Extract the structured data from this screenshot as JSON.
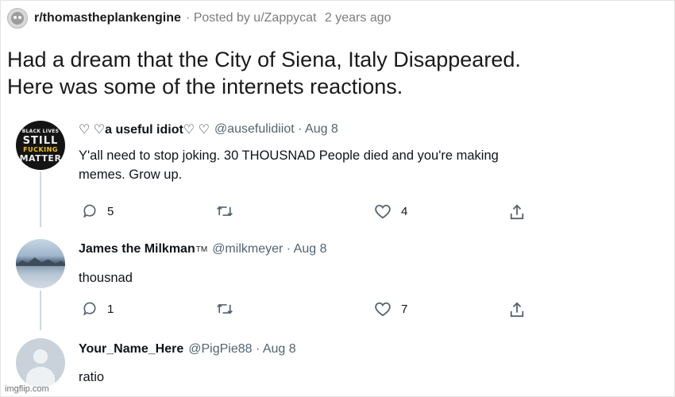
{
  "post": {
    "subreddit": "r/thomastheplankengine",
    "meta_posted": "· Posted by u/Zappycat",
    "meta_time": "2 years ago",
    "title_lines": [
      "Had a dream that the City of Siena, Italy Disappeared.",
      "Here was some of the internets reactions."
    ]
  },
  "tweets": [
    {
      "name": "♡ ♡a useful idiot♡ ♡",
      "handle": "@ausefulidiiot · Aug 8",
      "text_lines": [
        "Y'all need to stop joking. 30 THOUSNAD People died and you're making",
        "memes. Grow up."
      ],
      "avatar_text": [
        "BLACK LIVES",
        "STILL",
        "FUCKING",
        "MATTER"
      ],
      "replies": "5",
      "retweets": "",
      "likes": "4"
    },
    {
      "name": "James the Milkman",
      "name_mark": "TM",
      "handle": "@milkmeyer · Aug 8",
      "text_lines": [
        "thousnad"
      ],
      "replies": "1",
      "retweets": "",
      "likes": "7"
    },
    {
      "name": "Your_Name_Here",
      "handle": "@PigPie88 · Aug 8",
      "text_lines": [
        "ratio"
      ]
    }
  ],
  "watermark": "imgflip.com",
  "colors": {
    "text": "#0f1419",
    "muted": "#536471",
    "thread_line": "#cfd9de",
    "reddit_meta": "#7c7c7c"
  }
}
